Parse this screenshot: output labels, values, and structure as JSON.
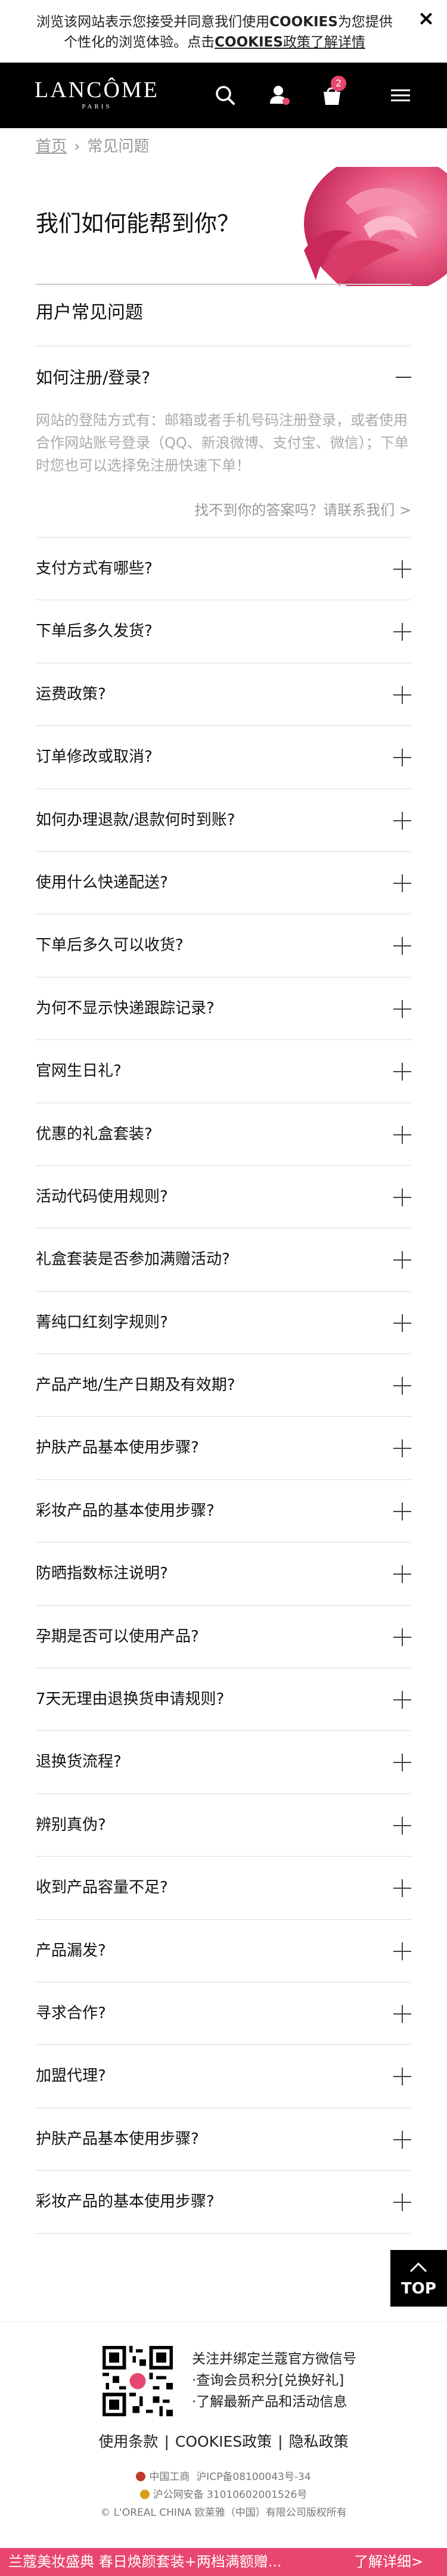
{
  "cookie": {
    "line1_a": "浏览该网站表示您接受并同意我们使用",
    "line1_b": "COOKIES",
    "line1_c": "为您提供",
    "line2_a": "个性化的浏览体验。点击",
    "line2_b": "COOKIES",
    "line2_c": "政策了解详情",
    "close": "×"
  },
  "header": {
    "logo": "LANCÔME",
    "logo_sub": "PARIS",
    "cart_count": "2",
    "icons": [
      "search-icon",
      "account-icon",
      "cart-icon",
      "menu-icon"
    ]
  },
  "breadcrumb": {
    "home": "首页",
    "separator": "›",
    "current": "常见问题"
  },
  "hero": {
    "title": "我们如何能帮到你？"
  },
  "section": {
    "title": "用户常见问题"
  },
  "open_item": {
    "question": "如何注册/登录?",
    "answer": "网站的登陆方式有：邮箱或者手机号码注册登录，或者使用合作网站账号登录（QQ、新浪微博、支付宝、微信）；下单时您也可以选择免注册快速下单！",
    "link": "找不到你的答案吗？请联系我们 >"
  },
  "faq": [
    "支付方式有哪些?",
    "下单后多久发货?",
    "运费政策?",
    "订单修改或取消?",
    "如何办理退款/退款何时到账?",
    "使用什么快递配送?",
    "下单后多久可以收货?",
    "为何不显示快递跟踪记录?",
    "官网生日礼?",
    "优惠的礼盒套装?",
    "活动代码使用规则?",
    "礼盒套装是否参加满赠活动?",
    "菁纯口红刻字规则?",
    "产品产地/生产日期及有效期?",
    "护肤产品基本使用步骤?",
    "彩妆产品的基本使用步骤?",
    "防晒指数标注说明?",
    "孕期是否可以使用产品?",
    "7天无理由退换货申请规则?",
    "退换货流程?",
    "辨别真伪?",
    "收到产品容量不足?",
    "产品漏发?",
    "寻求合作?",
    "加盟代理?",
    "护肤产品基本使用步骤?",
    "彩妆产品的基本使用步骤?"
  ],
  "top_button": {
    "label": "TOP"
  },
  "footer": {
    "qr_line1": "关注并绑定兰蔻官方微信号",
    "qr_line2": "·查询会员积分[兑换好礼]",
    "qr_line3": "·了解最新产品和活动信息",
    "terms": "使用条款",
    "cookies": "COOKIES政策",
    "privacy": "隐私政策",
    "link_sep": "|",
    "reg1": "中国工商",
    "reg1_b": "沪ICP备08100043号-34",
    "reg2": "沪公网安备 31010602001526号",
    "copyright": "© L'OREAL CHINA 欧莱雅（中国）有限公司版权所有"
  },
  "promo": {
    "text": "兰蔻美妆盛典 春日焕颜套装+两档满额赠...",
    "link": "了解详细>"
  },
  "colors": {
    "brand_black": "#000000",
    "accent_pink": "#e8466e"
  }
}
